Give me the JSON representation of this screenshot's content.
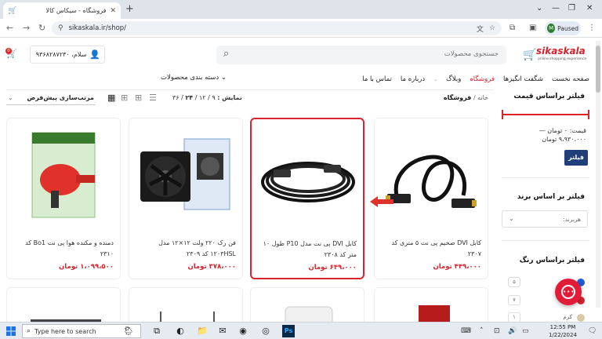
{
  "browser": {
    "tab_title": "فروشگاه - سیکاس کالا",
    "url": "sikaskala.ir/shop/",
    "profile_initial": "M",
    "profile_status": "Paused"
  },
  "header": {
    "logo_text": "sikaskala",
    "logo_tagline": "online shopping experience",
    "search_placeholder": "جستجوی محصولات",
    "login_text": "سلام، ۹۳۶۸۲۸۷۲۳۰",
    "cart_count": "0"
  },
  "menu": {
    "items": [
      {
        "label": "صفحه نخست",
        "active": false
      },
      {
        "label": "شگفت انگیزها",
        "active": false
      },
      {
        "label": "فروشگاه",
        "active": true
      },
      {
        "label": "وبلاگ",
        "active": false
      },
      {
        "label": "درباره ما",
        "active": false
      },
      {
        "label": "تماس با ما",
        "active": false
      }
    ],
    "categories_label": "دسته بندی محصولات"
  },
  "breadcrumb": {
    "home": "خانه",
    "sep": "/",
    "current": "فروشگاه"
  },
  "toolbar": {
    "show_label": "نمایش :",
    "opt_9": "۹",
    "opt_12": "۱۲",
    "opt_24": "۲۴",
    "opt_36": "۳۶",
    "sep": "/",
    "sort_label": "مرتب‌سازی پیش‌فرض"
  },
  "sidebar": {
    "price_title": "فیلتر براساس قیمت",
    "price_line1": "قیمت: ۰ تومان —",
    "price_line2": "۹،۹۳۰،۰۰۰ تومان",
    "filter_button": "فیلتر",
    "brand_title": "فیلتر بر اساس برند",
    "brand_placeholder": "هربرند:",
    "color_title": "فیلتر براساس رنگ",
    "colors": [
      {
        "hex": "#1e5bd6",
        "count": "۵",
        "name": ""
      },
      {
        "hex": "#d9232d",
        "count": "۷",
        "name": ""
      },
      {
        "hex": "#d8c9a8",
        "count": "۱",
        "name": "کرم"
      }
    ]
  },
  "products": [
    {
      "title": "کابل DVI ضخیم پی نت ۵ متری کد ۲۳۰۷",
      "price": "۴۴۹،۰۰۰ تومان"
    },
    {
      "title": "کابل DVI پی نت مدل P10 طول ۱۰ متر کد ۲۳۰۸",
      "price": "۶۴۹،۰۰۰ تومان"
    },
    {
      "title": "فن رک ۲۲۰ ولت ۱۲×۱۲ مدل ۱۲۰۳HSL کد ۲۳۰۹",
      "price": "۳۷۸،۰۰۰ تومان"
    },
    {
      "title": "دمنده و مکنده هوا پی نت Bo1 کد ۲۳۱۰",
      "price": "۱،۰۹۹،۵۰۰ تومان"
    }
  ],
  "taskbar": {
    "search_placeholder": "Type here to search",
    "time": "12:55 PM",
    "date": "1/22/2024"
  }
}
